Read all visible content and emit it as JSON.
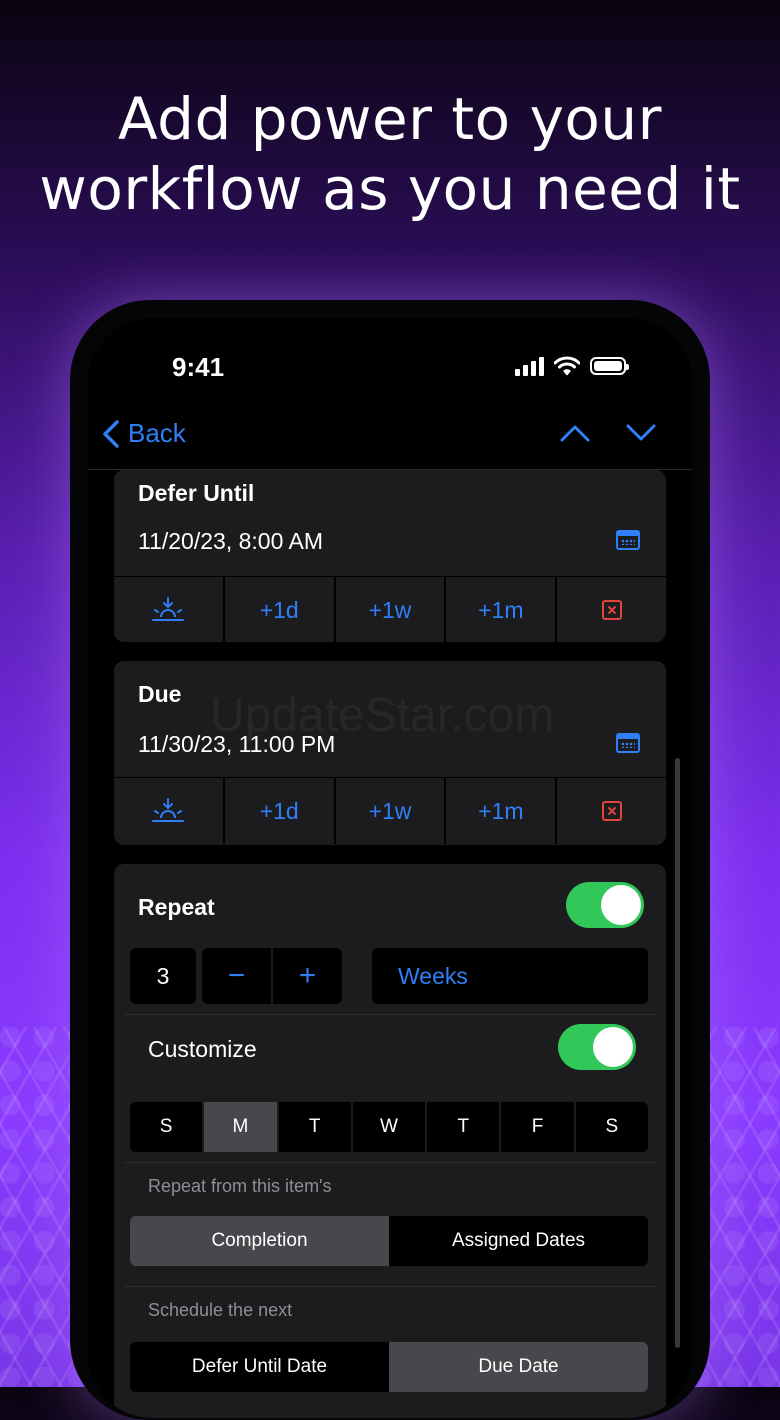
{
  "headline": {
    "line1": "Add power to your",
    "line2": "workflow as you need it"
  },
  "status_bar": {
    "time": "9:41"
  },
  "nav": {
    "back_label": "Back"
  },
  "defer": {
    "title": "Defer Until",
    "date": "11/20/23, 8:00 AM",
    "quick": [
      "+1d",
      "+1w",
      "+1m"
    ]
  },
  "due": {
    "title": "Due",
    "date": "11/30/23, 11:00 PM",
    "quick": [
      "+1d",
      "+1w",
      "+1m"
    ]
  },
  "watermark": "UpdateStar.com",
  "repeat": {
    "label": "Repeat",
    "enabled": true,
    "interval": "3",
    "minus": "−",
    "plus": "+",
    "unit": "Weeks",
    "customize_label": "Customize",
    "customize_enabled": true,
    "days": [
      "S",
      "M",
      "T",
      "W",
      "T",
      "F",
      "S"
    ],
    "selected_day_index": 1,
    "repeat_from_caption": "Repeat from this item's",
    "repeat_from_options": [
      "Completion",
      "Assigned Dates"
    ],
    "repeat_from_selected": 0,
    "schedule_caption": "Schedule the next",
    "schedule_options": [
      "Defer Until Date",
      "Due Date"
    ],
    "schedule_selected": 1
  },
  "colors": {
    "accent": "#2f7ff7",
    "toggle_on": "#31c759",
    "clear": "#e0463c"
  }
}
